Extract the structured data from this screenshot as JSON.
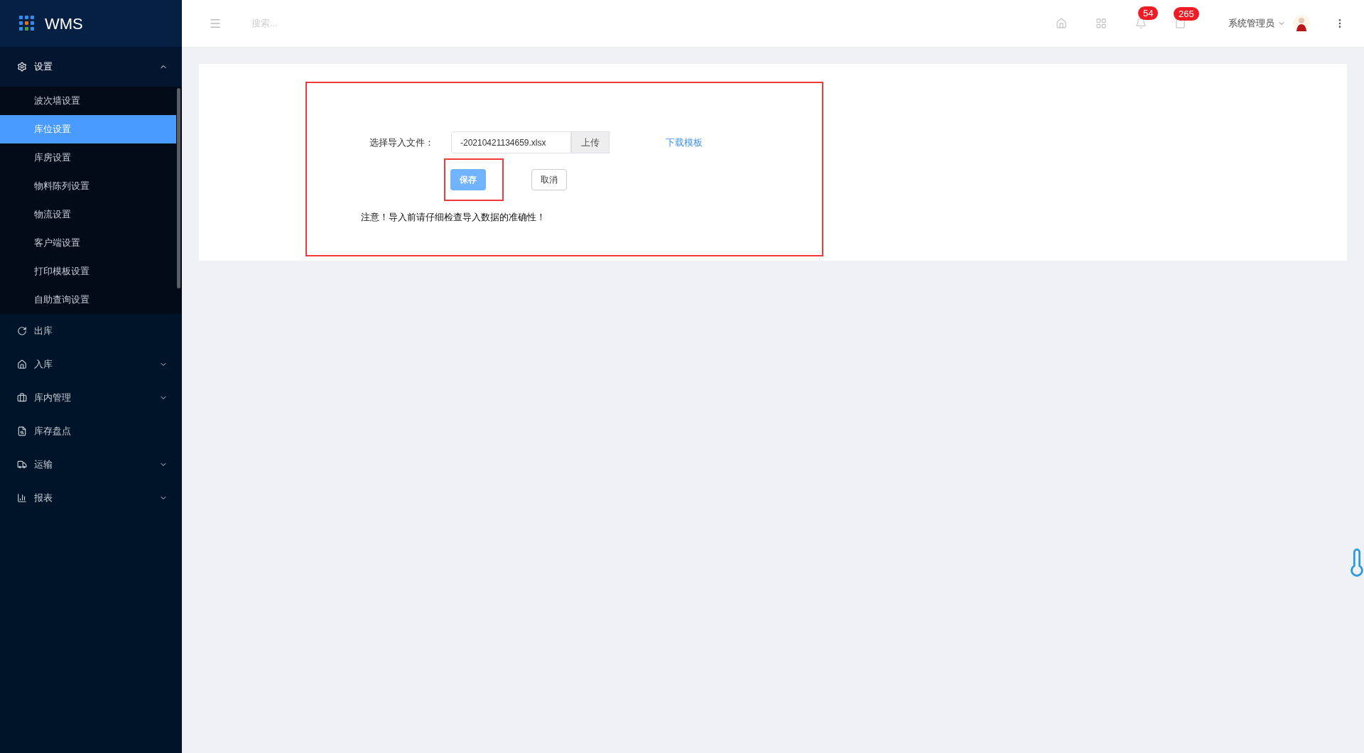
{
  "app": {
    "name": "WMS"
  },
  "search": {
    "placeholder": "搜索..."
  },
  "sidebar": {
    "items": [
      {
        "label": "设置",
        "kind": "group",
        "expanded": true,
        "children": [
          {
            "label": "波次墙设置",
            "selected": false
          },
          {
            "label": "库位设置",
            "selected": true
          },
          {
            "label": "库房设置",
            "selected": false
          },
          {
            "label": "物料陈列设置",
            "selected": false
          },
          {
            "label": "物流设置",
            "selected": false
          },
          {
            "label": "客户端设置",
            "selected": false
          },
          {
            "label": "打印模板设置",
            "selected": false
          },
          {
            "label": "自助查询设置",
            "selected": false
          }
        ]
      },
      {
        "label": "出库",
        "kind": "link"
      },
      {
        "label": "入库",
        "kind": "group",
        "expanded": false
      },
      {
        "label": "库内管理",
        "kind": "group",
        "expanded": false
      },
      {
        "label": "库存盘点",
        "kind": "link"
      },
      {
        "label": "运输",
        "kind": "group",
        "expanded": false
      },
      {
        "label": "报表",
        "kind": "group",
        "expanded": false
      }
    ]
  },
  "header": {
    "notifications": "54",
    "messages": "265",
    "user": "系统管理员"
  },
  "import_form": {
    "label": "选择导入文件：",
    "file": "-20210421134659.xlsx",
    "upload": "上传",
    "download": "下载模板",
    "save": "保存",
    "cancel": "取消",
    "note": "注意！导入前请仔细检查导入数据的准确性！"
  }
}
